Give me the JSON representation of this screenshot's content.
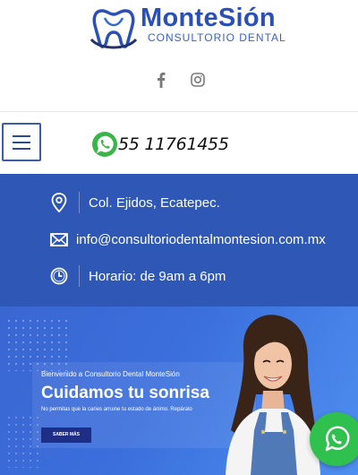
{
  "brand": {
    "name": "MonteSión",
    "tagline": "CONSULTORIO DENTAL"
  },
  "social": {
    "facebook_icon": "facebook-icon",
    "instagram_icon": "instagram-icon"
  },
  "nav": {
    "menu_icon": "hamburger-menu-icon",
    "whatsapp_icon": "whatsapp-icon",
    "phone": "55 11761455"
  },
  "contact": {
    "address": "Col. Ejidos, Ecatepec.",
    "email": "info@consultoriodentalmontesion.com.mx",
    "hours": "Horario: de 9am a 6pm"
  },
  "hero": {
    "kicker": "Bienvenido a Consultorio Dental MonteSión",
    "title": "Cuidamos tu sonrisa",
    "description": "No permitas que la caries arruine tu estado de ánimo. Repáralo",
    "button_label": "SABER MÁS"
  },
  "colors": {
    "brand_blue": "#2a50b8",
    "contact_band": "#2f58b6",
    "hero_button": "#1e2e86",
    "whatsapp_green": "#2fc04d"
  }
}
